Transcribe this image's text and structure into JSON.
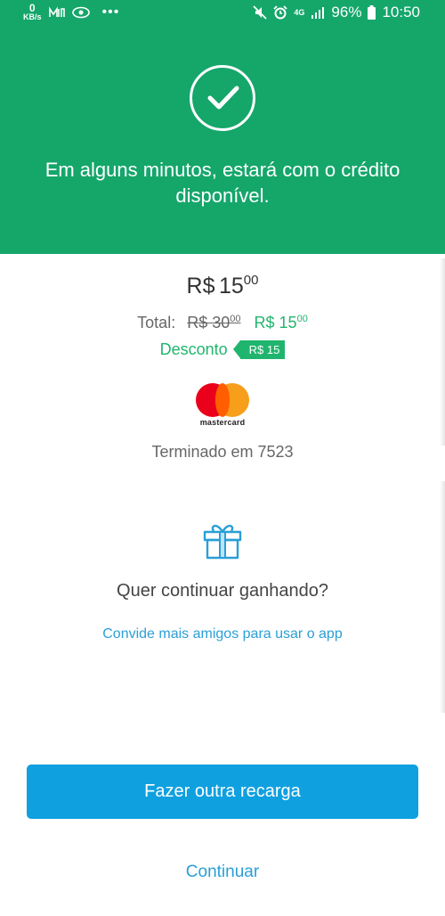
{
  "status_bar": {
    "net_speed_value": "0",
    "net_speed_unit": "KB/s",
    "network": "4G",
    "battery": "96%",
    "time": "10:50"
  },
  "hero": {
    "message": "Em alguns minutos, estará com o crédito disponível."
  },
  "amount": {
    "currency": "R$",
    "integer": "15",
    "decimals": "00"
  },
  "total": {
    "label": "Total:",
    "old_integer": "R$ 30",
    "old_decimals": "00",
    "new_integer": "R$ 15",
    "new_decimals": "00"
  },
  "discount": {
    "label": "Desconto",
    "tag": "R$ 15"
  },
  "card": {
    "brand": "mastercard",
    "ending": "Terminado em 7523"
  },
  "referral": {
    "question": "Quer continuar ganhando?",
    "invite_link": "Convide mais amigos para usar o app"
  },
  "actions": {
    "primary": "Fazer outra recarga",
    "secondary": "Continuar"
  },
  "colors": {
    "brand_green": "#15a66a",
    "accent_green": "#20b56e",
    "primary_blue": "#0fa0e0",
    "link_blue": "#2a9fd6"
  }
}
